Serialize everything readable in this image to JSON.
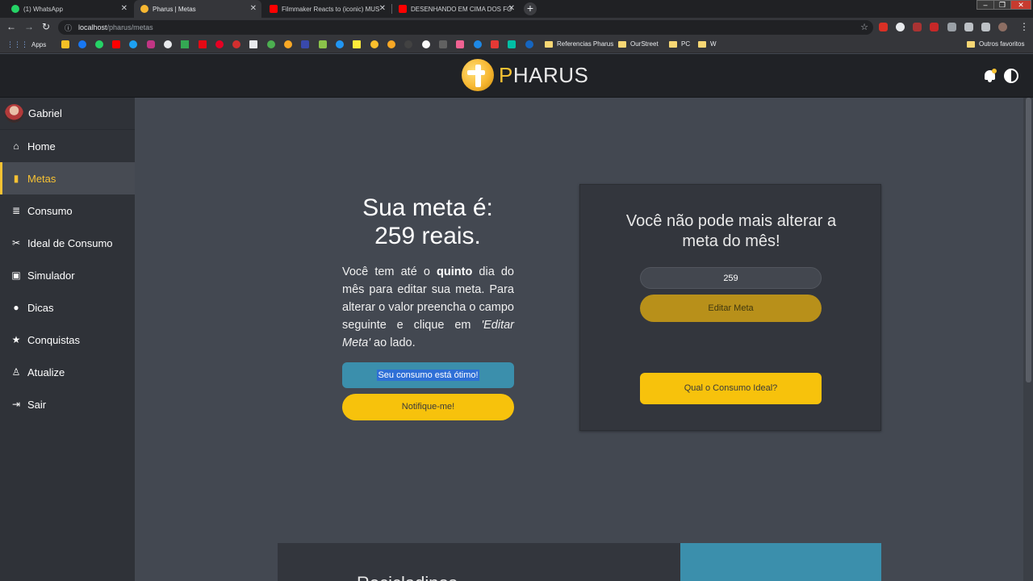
{
  "browser": {
    "tabs": [
      {
        "title": "(1) WhatsApp",
        "color": "#25d366"
      },
      {
        "title": "Pharus | Metas",
        "color": "#f7b731"
      },
      {
        "title": "Filmmaker Reacts to (iconic) MUS",
        "color": "#ff0000"
      },
      {
        "title": "DESENHANDO EM CIMA DOS FO",
        "color": "#ff0000"
      }
    ],
    "url_host": "localhost",
    "url_path": "/pharus/metas",
    "bookmarks": {
      "apps": "Apps",
      "folders": [
        "Referencias Pharus",
        "OurStreet",
        "PC",
        "W"
      ],
      "other": "Outros favoritos"
    }
  },
  "header": {
    "logo_first": "P",
    "logo_rest": "HARUS"
  },
  "sidebar": {
    "user_name": "Gabriel",
    "items": [
      {
        "label": "Home",
        "icon": "home-icon"
      },
      {
        "label": "Metas",
        "icon": "bookmark-icon"
      },
      {
        "label": "Consumo",
        "icon": "coins-icon"
      },
      {
        "label": "Ideal de Consumo",
        "icon": "ideal-icon"
      },
      {
        "label": "Simulador",
        "icon": "monitor-icon"
      },
      {
        "label": "Dicas",
        "icon": "lightbulb-icon"
      },
      {
        "label": "Conquistas",
        "icon": "star-icon"
      },
      {
        "label": "Atualize",
        "icon": "award-icon"
      },
      {
        "label": "Sair",
        "icon": "logout-icon"
      }
    ],
    "active_index": 1
  },
  "goal": {
    "title_line1": "Sua meta é:",
    "title_line2": "259 reais.",
    "desc_part1": "Você tem até o ",
    "desc_bold": "quinto",
    "desc_part2": " dia do mês para editar sua meta. Para alterar o valor preencha o campo seguinte e clique em ",
    "desc_italic": "'Editar Meta'",
    "desc_part3": " ao lado.",
    "status_label": "Seu consumo está ótimo!",
    "notify_label": "Notifique-me!"
  },
  "edit_card": {
    "title": "Você não pode mais alterar a meta do mês!",
    "input_value": "259",
    "edit_label": "Editar Meta",
    "ideal_label": "Qual o Consumo Ideal?"
  },
  "bottom": {
    "partial_text": "Recicladinos"
  },
  "colors": {
    "accent": "#f7c20c",
    "status_blue": "#3b8fac",
    "sidebar_bg": "#2f3238",
    "main_bg": "#434851"
  }
}
